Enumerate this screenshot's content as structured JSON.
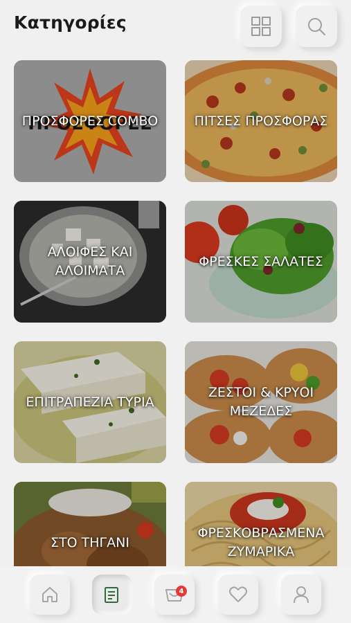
{
  "header": {
    "title": "Κατηγορίες",
    "grid_icon": "grid-view-icon",
    "search_icon": "search-icon"
  },
  "categories": [
    {
      "label": "ΠΡΟΣΦΟΡΕΣ COMBO",
      "image": "sale-burst"
    },
    {
      "label": "ΠΙΤΣΕΣ ΠΡΟΣΦΟΡΑΣ",
      "image": "pizza"
    },
    {
      "label": "ΑΛΟΙΦΕΣ ΚΑΙ ΑΛΟΙΜΑΤΑ",
      "image": "feta-dip-plate"
    },
    {
      "label": "ΦΡΕΣΚΕΣ ΣΑΛΑΤΕΣ",
      "image": "salad-bowl"
    },
    {
      "label": "ΕΠΙΤΡΑΠΕΖΙΑ ΤΥΡΙΑ",
      "image": "feta-cheese"
    },
    {
      "label": "ΖΕΣΤΟΙ & ΚΡΥΟΙ ΜΕΖΕΔΕΣ",
      "image": "bruschetta"
    },
    {
      "label": "ΣΤΟ ΤΗΓΑΝΙ",
      "image": "fried-meat"
    },
    {
      "label": "ΦΡΕΣΚΟΒΡΑΣΜΕΝΑ ΖΥΜΑΡΙΚΑ",
      "image": "spaghetti"
    }
  ],
  "bottom_nav": {
    "items": [
      {
        "icon": "home-icon"
      },
      {
        "icon": "menu-document-icon",
        "active": true
      },
      {
        "icon": "cart-icon",
        "badge": "4"
      },
      {
        "icon": "heart-icon"
      },
      {
        "icon": "user-icon"
      }
    ]
  },
  "colors": {
    "background": "#f0f0f0",
    "active_icon": "#2e6b3a",
    "badge": "#e53935"
  }
}
